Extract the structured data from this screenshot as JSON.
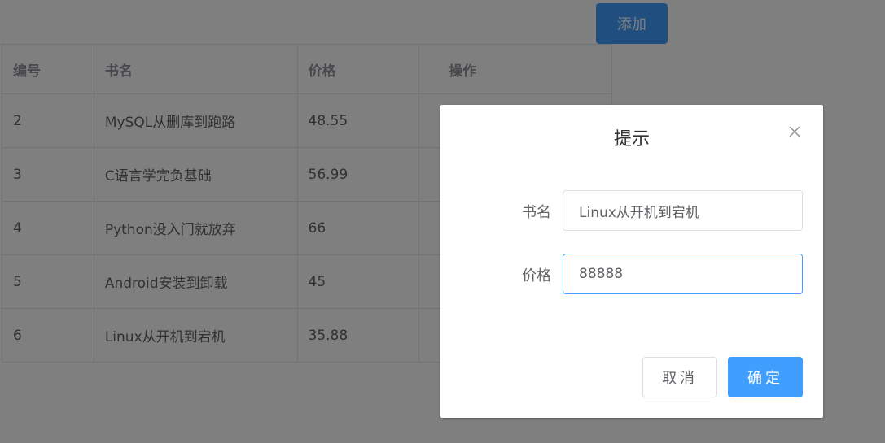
{
  "toolbar": {
    "add_label": "添加"
  },
  "table": {
    "headers": {
      "id": "编号",
      "name": "书名",
      "price": "价格",
      "operation": "操作"
    },
    "rows": [
      {
        "id": "2",
        "name": "MySQL从删库到跑路",
        "price": "48.55"
      },
      {
        "id": "3",
        "name": "C语言学完负基础",
        "price": "56.99"
      },
      {
        "id": "4",
        "name": "Python没入门就放弃",
        "price": "66"
      },
      {
        "id": "5",
        "name": "Android安装到卸载",
        "price": "45"
      },
      {
        "id": "6",
        "name": "Linux从开机到宕机",
        "price": "35.88"
      }
    ]
  },
  "dialog": {
    "title": "提示",
    "close_icon": "close-icon",
    "name_label": "书名",
    "name_value": "Linux从开机到宕机",
    "price_label": "价格",
    "price_value": "88888",
    "cancel_label": "取消",
    "confirm_label": "确定"
  },
  "colors": {
    "primary": "#409eff",
    "overlay": "rgba(0,0,0,0.5)",
    "border": "#dcdfe6",
    "text": "#606266"
  }
}
